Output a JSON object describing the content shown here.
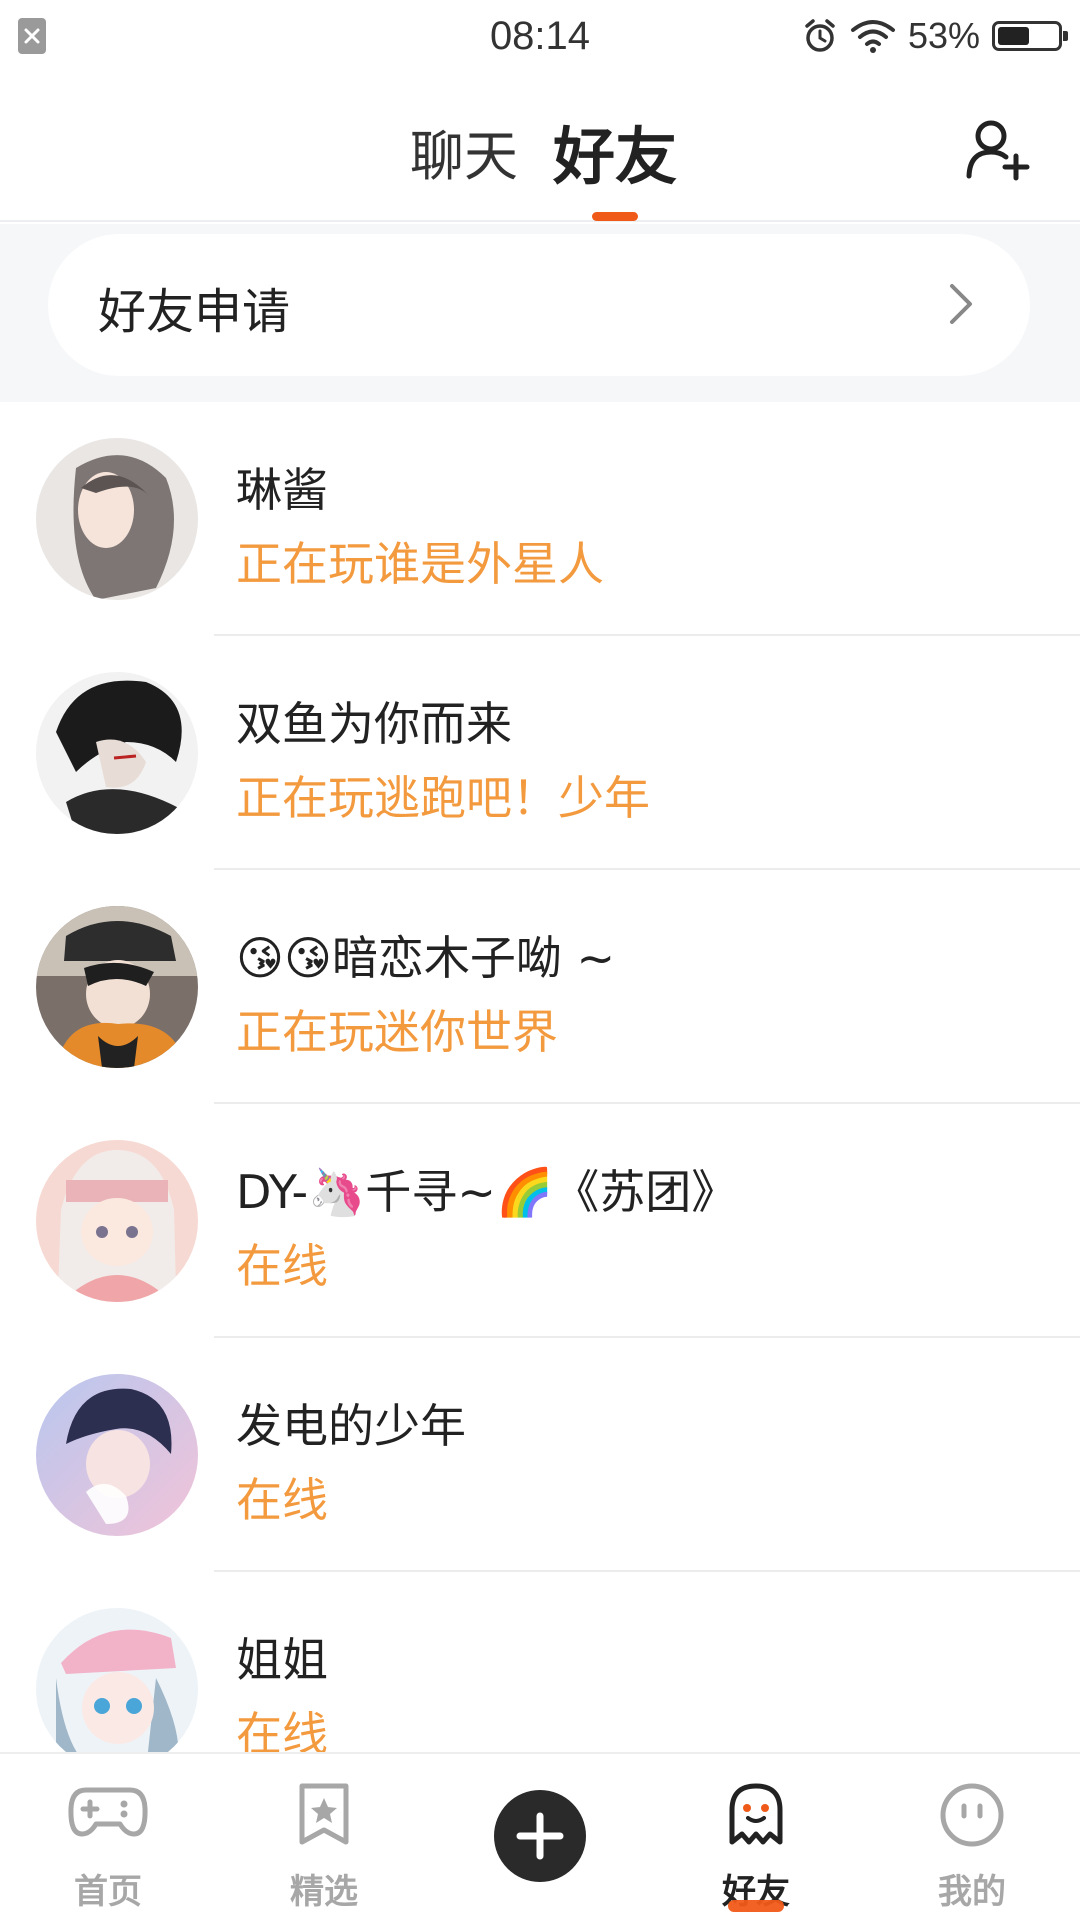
{
  "status_bar": {
    "time": "08:14",
    "battery_percent": "53%",
    "battery_level": 0.53
  },
  "header": {
    "tabs": [
      {
        "label": "聊天",
        "active": false
      },
      {
        "label": "好友",
        "active": true
      }
    ],
    "add_friend_icon": "person-add-icon",
    "accent_color": "#f05a18"
  },
  "friend_request": {
    "label": "好友申请",
    "icon": "chevron-right-icon"
  },
  "friends": [
    {
      "name": "琳酱",
      "status": "正在玩谁是外星人"
    },
    {
      "name": "双鱼为你而来",
      "status": "正在玩逃跑吧！少年"
    },
    {
      "name": "😘😘暗恋木子呦 ~",
      "status": "正在玩迷你世界"
    },
    {
      "name": "DY-🦄千寻~🌈《苏团》",
      "status": "在线"
    },
    {
      "name": "发电的少年",
      "status": "在线"
    },
    {
      "name": "姐姐",
      "status": "在线"
    }
  ],
  "status_color": "#f39a3f",
  "bottom_nav": [
    {
      "label": "首页",
      "icon": "gamepad-icon",
      "active": false
    },
    {
      "label": "精选",
      "icon": "star-badge-icon",
      "active": false
    },
    {
      "label": "",
      "icon": "plus-icon",
      "active": false
    },
    {
      "label": "好友",
      "icon": "ghost-icon",
      "active": true
    },
    {
      "label": "我的",
      "icon": "face-icon",
      "active": false
    }
  ]
}
